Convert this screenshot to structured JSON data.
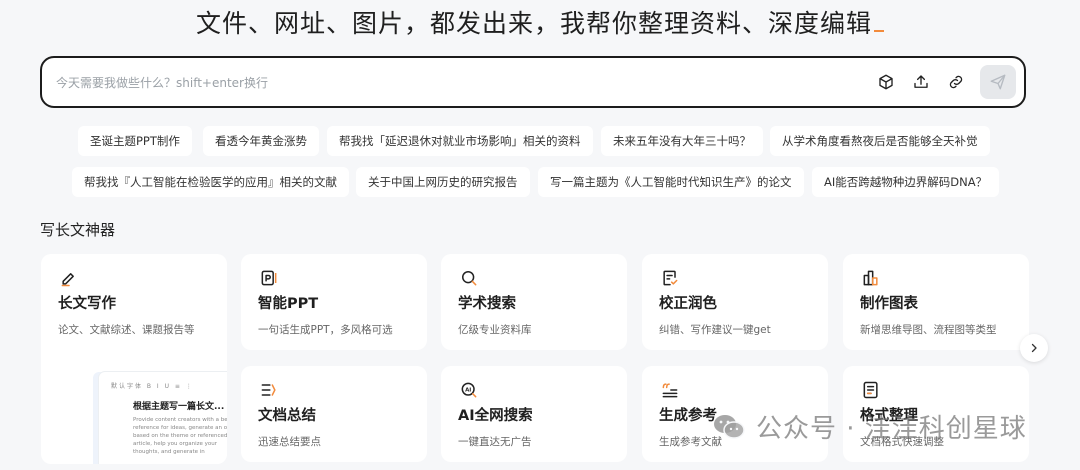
{
  "headline": "文件、网址、图片，都发出来，我帮你整理资料、深度编辑",
  "chat": {
    "placeholder": "今天需要我做些什么？shift+enter换行",
    "tools": [
      "cube-icon",
      "upload-icon",
      "link-icon"
    ],
    "send_icon": "send-icon"
  },
  "suggestions_row1": [
    "圣诞主题PPT制作",
    "看透今年黄金涨势",
    "帮我找「延迟退休对就业市场影响」相关的资料",
    "未来五年没有大年三十吗？",
    "从学术角度看熬夜后是否能够全天补觉"
  ],
  "suggestions_row2": [
    "帮我找『人工智能在检验医学的应用』相关的文献",
    "关于中国上网历史的研究报告",
    "写一篇主题为《人工智能时代知识生产》的论文",
    "AI能否跨越物种边界解码DNA？"
  ],
  "section_title": "写长文神器",
  "cards": [
    {
      "title": "长文写作",
      "desc": "论文、文献综述、课题报告等",
      "icon": "pen-icon"
    },
    {
      "title": "智能PPT",
      "desc": "一句话生成PPT，多风格可选",
      "icon": "ppt-icon"
    },
    {
      "title": "学术搜索",
      "desc": "亿级专业资料库",
      "icon": "search-icon"
    },
    {
      "title": "校正润色",
      "desc": "纠错、写作建议一键get",
      "icon": "proofread-icon"
    },
    {
      "title": "制作图表",
      "desc": "新增思维导图、流程图等类型",
      "icon": "chart-icon"
    },
    {
      "title": "文档总结",
      "desc": "迅速总结要点",
      "icon": "summary-icon"
    },
    {
      "title": "AI全网搜索",
      "desc": "一键直达无广告",
      "icon": "ai-search-icon"
    },
    {
      "title": "生成参考",
      "desc": "生成参考文献",
      "icon": "quote-icon"
    },
    {
      "title": "格式整理",
      "desc": "文档格式快速调整",
      "icon": "format-icon"
    }
  ],
  "preview": {
    "toolbar": "默认字体  B  I  U  ≡  ⋮",
    "title": "根据主题写一篇长文...",
    "text": "Provide content creators with a better reference for ideas, generate an outline based on the theme or referenced article, help you organize your thoughts, and generate in"
  },
  "watermark": "公众号 · 洼洼科创星球",
  "colors": {
    "accent": "#f28b3c",
    "border": "#1c1c1c",
    "background": "#f6f7f9"
  }
}
